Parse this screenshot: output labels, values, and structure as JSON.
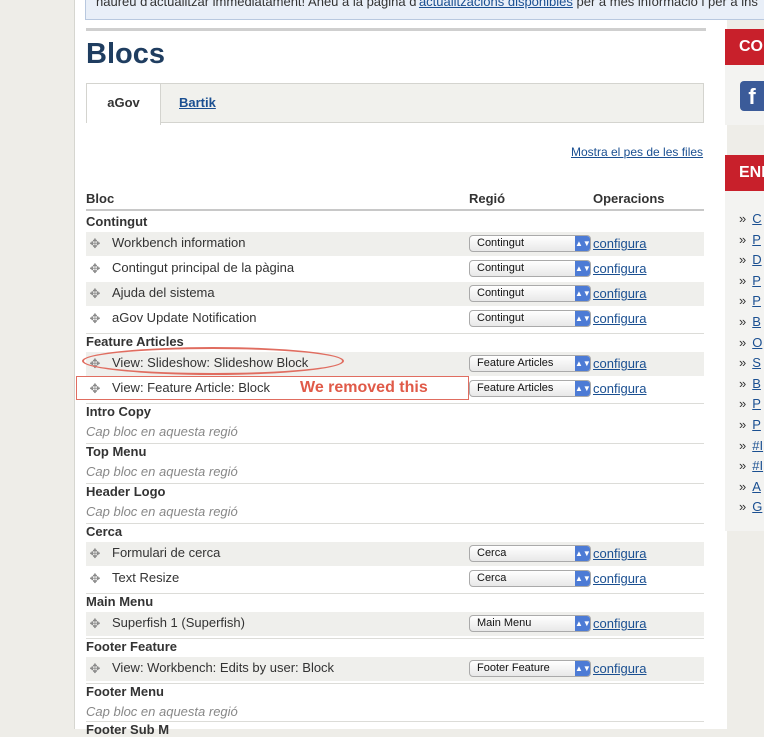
{
  "notice": {
    "prefix": "haureu d'actualitzar immediatament! Aneu a la pàgina d'",
    "link": "actualitzacions disponibles",
    "suffix": " per a més informació i per a ins"
  },
  "page_title": "Blocs",
  "tabs": [
    {
      "label": "aGov"
    },
    {
      "label": "Bartik"
    }
  ],
  "show_weights": "Mostra el pes de les files",
  "columns": {
    "block": "Bloc",
    "region": "Regió",
    "operations": "Operacions"
  },
  "empty_text": "Cap bloc en aquesta regió",
  "configure": "configura",
  "annotation": "We removed this",
  "regions": [
    {
      "name": "Contingut",
      "blocks": [
        {
          "name": "Workbench information",
          "region": "Contingut"
        },
        {
          "name": "Contingut principal de la pàgina",
          "region": "Contingut"
        },
        {
          "name": "Ajuda del sistema",
          "region": "Contingut"
        },
        {
          "name": "aGov Update Notification",
          "region": "Contingut"
        }
      ]
    },
    {
      "name": "Feature Articles",
      "blocks": [
        {
          "name": "View: Slideshow: Slideshow Block",
          "region": "Feature Articles"
        },
        {
          "name": "View: Feature Article: Block",
          "region": "Feature Articles"
        }
      ]
    },
    {
      "name": "Intro Copy",
      "blocks": []
    },
    {
      "name": "Top Menu",
      "blocks": []
    },
    {
      "name": "Header Logo",
      "blocks": []
    },
    {
      "name": "Cerca",
      "blocks": [
        {
          "name": "Formulari de cerca",
          "region": "Cerca"
        },
        {
          "name": "Text Resize",
          "region": "Cerca"
        }
      ]
    },
    {
      "name": "Main Menu",
      "blocks": [
        {
          "name": "Superfish 1 (Superfish)",
          "region": "Main Menu"
        }
      ]
    },
    {
      "name": "Footer Feature",
      "blocks": [
        {
          "name": "View: Workbench: Edits by user: Block",
          "region": "Footer Feature"
        }
      ]
    },
    {
      "name": "Footer Menu",
      "blocks": []
    },
    {
      "name": "Footer Sub M"
    }
  ],
  "sidebar": {
    "header1": "CO",
    "header2": "ENI",
    "facebook_icon": "facebook-icon",
    "items": [
      "C",
      "P",
      "D",
      "P",
      "P",
      "B",
      "O",
      "S",
      "B",
      "P",
      "P",
      "#I",
      "#I",
      "A",
      "G"
    ]
  },
  "colors": {
    "accent": "#c8202b",
    "link": "#1a4f91",
    "title": "#1f3d60",
    "annotation": "#e05a48"
  }
}
